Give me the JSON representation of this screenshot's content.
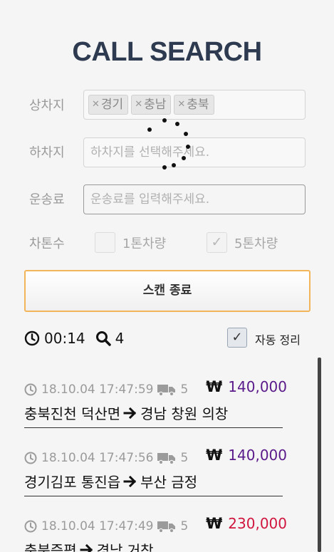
{
  "title": "CALL SEARCH",
  "form": {
    "origin_label": "상차지",
    "origin_tags": [
      "경기",
      "충남",
      "충북"
    ],
    "dest_label": "하차지",
    "dest_placeholder": "하차지를 선택해주세요.",
    "fare_label": "운송료",
    "fare_placeholder": "운송료를 입력해주세요.",
    "tonnage_label": "차톤수",
    "ton1_label": "1톤차량",
    "ton1_checked": false,
    "ton5_label": "5톤차량",
    "ton5_checked": true
  },
  "scan_button": "스캔 종료",
  "stats": {
    "elapsed": "00:14",
    "found": "4"
  },
  "auto_sort": {
    "label": "자동 정리",
    "checked": true
  },
  "calls": [
    {
      "time": "18.10.04 17:47:59",
      "tonnage": "5",
      "price": "140,000",
      "price_color": "#5a1a8a",
      "route_from": "충북진천 덕산면",
      "route_to": "경남 창원 의창"
    },
    {
      "time": "18.10.04 17:47:56",
      "tonnage": "5",
      "price": "140,000",
      "price_color": "#5a1a8a",
      "route_from": "경기김포 통진읍",
      "route_to": "부산 금정"
    },
    {
      "time": "18.10.04 17:47:49",
      "tonnage": "5",
      "price": "230,000",
      "price_color": "#d0163e",
      "route_from": "충북증평",
      "route_to": "경남 거창"
    }
  ],
  "currency_symbol": "₩",
  "icons": {
    "clock": "clock-icon",
    "search": "search-icon",
    "truck": "truck-icon",
    "arrow": "arrow-right-icon",
    "check": "check-icon",
    "spinner": "loading-spinner"
  }
}
